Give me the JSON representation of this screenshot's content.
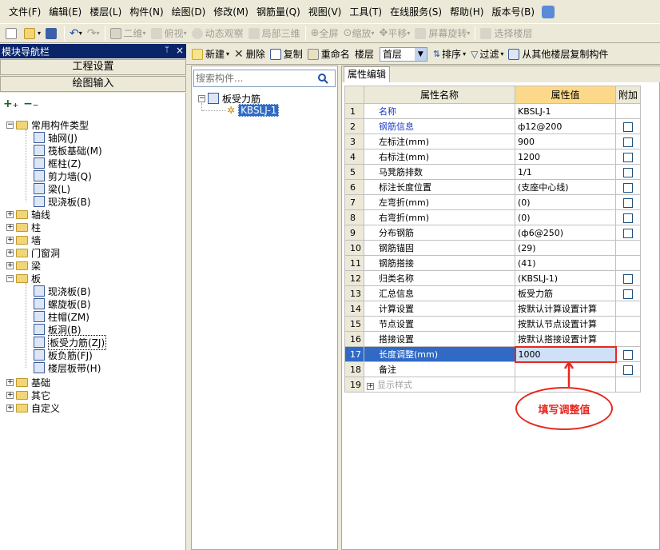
{
  "menu": [
    "文件(F)",
    "编辑(E)",
    "楼层(L)",
    "构件(N)",
    "绘图(D)",
    "修改(M)",
    "钢筋量(Q)",
    "视图(V)",
    "工具(T)",
    "在线服务(S)",
    "帮助(H)",
    "版本号(B)"
  ],
  "toolbar": {
    "view2d": "二维",
    "top_view": "俯视",
    "dynamic": "动态观察",
    "local3d": "局部三维",
    "fullscreen": "全屏",
    "zoom": "缩放",
    "pan": "平移",
    "rotate": "屏幕旋转",
    "select_floor": "选择楼层"
  },
  "left_panel": {
    "title": "模块导航栏",
    "btn_project": "工程设置",
    "btn_draw": "绘图输入",
    "tree": {
      "common": "常用构件类型",
      "common_items": [
        "轴网(J)",
        "筏板基础(M)",
        "框柱(Z)",
        "剪力墙(Q)",
        "梁(L)",
        "现浇板(B)"
      ],
      "groups": [
        "轴线",
        "柱",
        "墙",
        "门窗洞",
        "梁"
      ],
      "slab": "板",
      "slab_items": [
        "现浇板(B)",
        "螺旋板(B)",
        "柱帽(ZM)",
        "板洞(B)",
        "板受力筋(ZJ)",
        "板负筋(FJ)",
        "楼层板带(H)"
      ],
      "bottom_groups": [
        "基础",
        "其它",
        "自定义"
      ]
    }
  },
  "mid_toolbar": {
    "new": "新建",
    "delete": "删除",
    "copy": "复制",
    "rename": "重命名",
    "floor_label": "楼层",
    "floor_value": "首层",
    "sort": "排序",
    "filter": "过滤",
    "copy_from": "从其他楼层复制构件"
  },
  "mid_panel": {
    "search_placeholder": "搜索构件...",
    "root": "板受力筋",
    "child": "KBSLJ-1"
  },
  "right_panel": {
    "tab": "属性编辑",
    "headers": [
      "属性名称",
      "属性值",
      "附加"
    ],
    "rows": [
      {
        "n": "1",
        "name": "名称",
        "value": "KBSLJ-1",
        "blue": true,
        "cb": false
      },
      {
        "n": "2",
        "name": "钢筋信息",
        "value": "ф12@200",
        "blue": true,
        "cb": true
      },
      {
        "n": "3",
        "name": "左标注(mm)",
        "value": "900",
        "blue": false,
        "cb": true
      },
      {
        "n": "4",
        "name": "右标注(mm)",
        "value": "1200",
        "blue": false,
        "cb": true
      },
      {
        "n": "5",
        "name": "马凳筋排数",
        "value": "1/1",
        "blue": false,
        "cb": true
      },
      {
        "n": "6",
        "name": "标注长度位置",
        "value": "(支座中心线)",
        "blue": false,
        "cb": true
      },
      {
        "n": "7",
        "name": "左弯折(mm)",
        "value": "(0)",
        "blue": false,
        "cb": true
      },
      {
        "n": "8",
        "name": "右弯折(mm)",
        "value": "(0)",
        "blue": false,
        "cb": true
      },
      {
        "n": "9",
        "name": "分布钢筋",
        "value": "(ф6@250)",
        "blue": false,
        "cb": true
      },
      {
        "n": "10",
        "name": "钢筋锚固",
        "value": "(29)",
        "blue": false,
        "cb": false
      },
      {
        "n": "11",
        "name": "钢筋搭接",
        "value": "(41)",
        "blue": false,
        "cb": false
      },
      {
        "n": "12",
        "name": "归类名称",
        "value": "(KBSLJ-1)",
        "blue": false,
        "cb": true
      },
      {
        "n": "13",
        "name": "汇总信息",
        "value": "板受力筋",
        "blue": false,
        "cb": true
      },
      {
        "n": "14",
        "name": "计算设置",
        "value": "按默认计算设置计算",
        "blue": false,
        "cb": false
      },
      {
        "n": "15",
        "name": "节点设置",
        "value": "按默认节点设置计算",
        "blue": false,
        "cb": false
      },
      {
        "n": "16",
        "name": "搭接设置",
        "value": "按默认搭接设置计算",
        "blue": false,
        "cb": false
      },
      {
        "n": "17",
        "name": "长度调整(mm)",
        "value": "1000",
        "blue": false,
        "cb": true,
        "selected": true
      },
      {
        "n": "18",
        "name": "备注",
        "value": "",
        "blue": false,
        "cb": true
      }
    ],
    "display_style": {
      "n": "19",
      "name": "显示样式"
    }
  },
  "annotation": "填写调整值"
}
